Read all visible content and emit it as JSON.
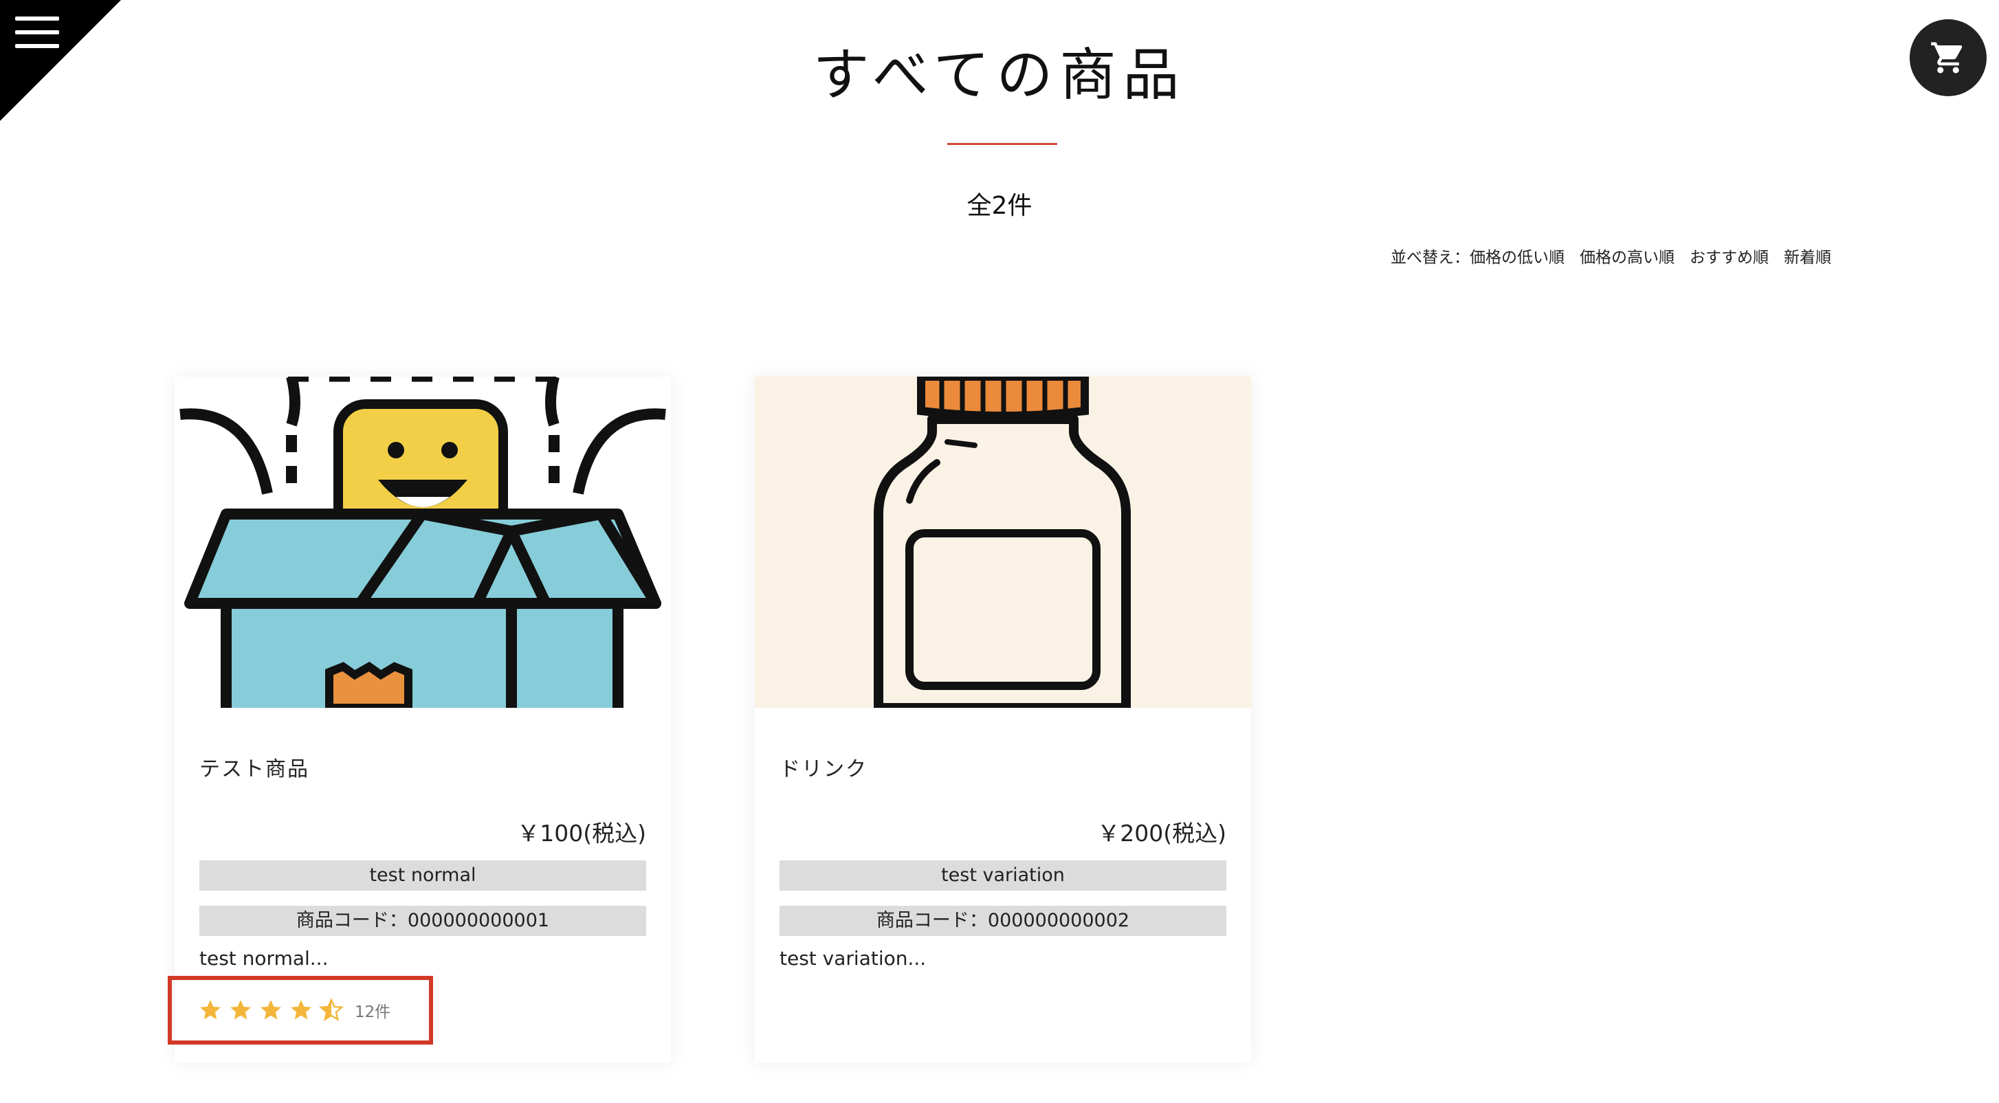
{
  "header": {
    "menu_icon": "hamburger-menu-icon",
    "cart_icon": "shopping-cart-icon",
    "title": "すべての商品",
    "accent_color": "#d24a3a",
    "count": "全2件"
  },
  "sort": {
    "label": "並べ替え：",
    "options": [
      "価格の低い順",
      "価格の高い順",
      "おすすめ順",
      "新着順"
    ]
  },
  "products": [
    {
      "image_icon": "box-character-illustration",
      "name": "テスト商品",
      "price": "￥100(税込)",
      "variant": "test normal",
      "code": "商品コード：000000000001",
      "description": "test normal...",
      "rating": {
        "stars": 4.5,
        "count": "12件",
        "star_color": "#f3b63a",
        "highlight_color": "#d23a26"
      }
    },
    {
      "image_icon": "bottle-illustration",
      "name": "ドリンク",
      "price": "￥200(税込)",
      "variant": "test variation",
      "code": "商品コード：000000000002",
      "description": "test variation..."
    }
  ]
}
